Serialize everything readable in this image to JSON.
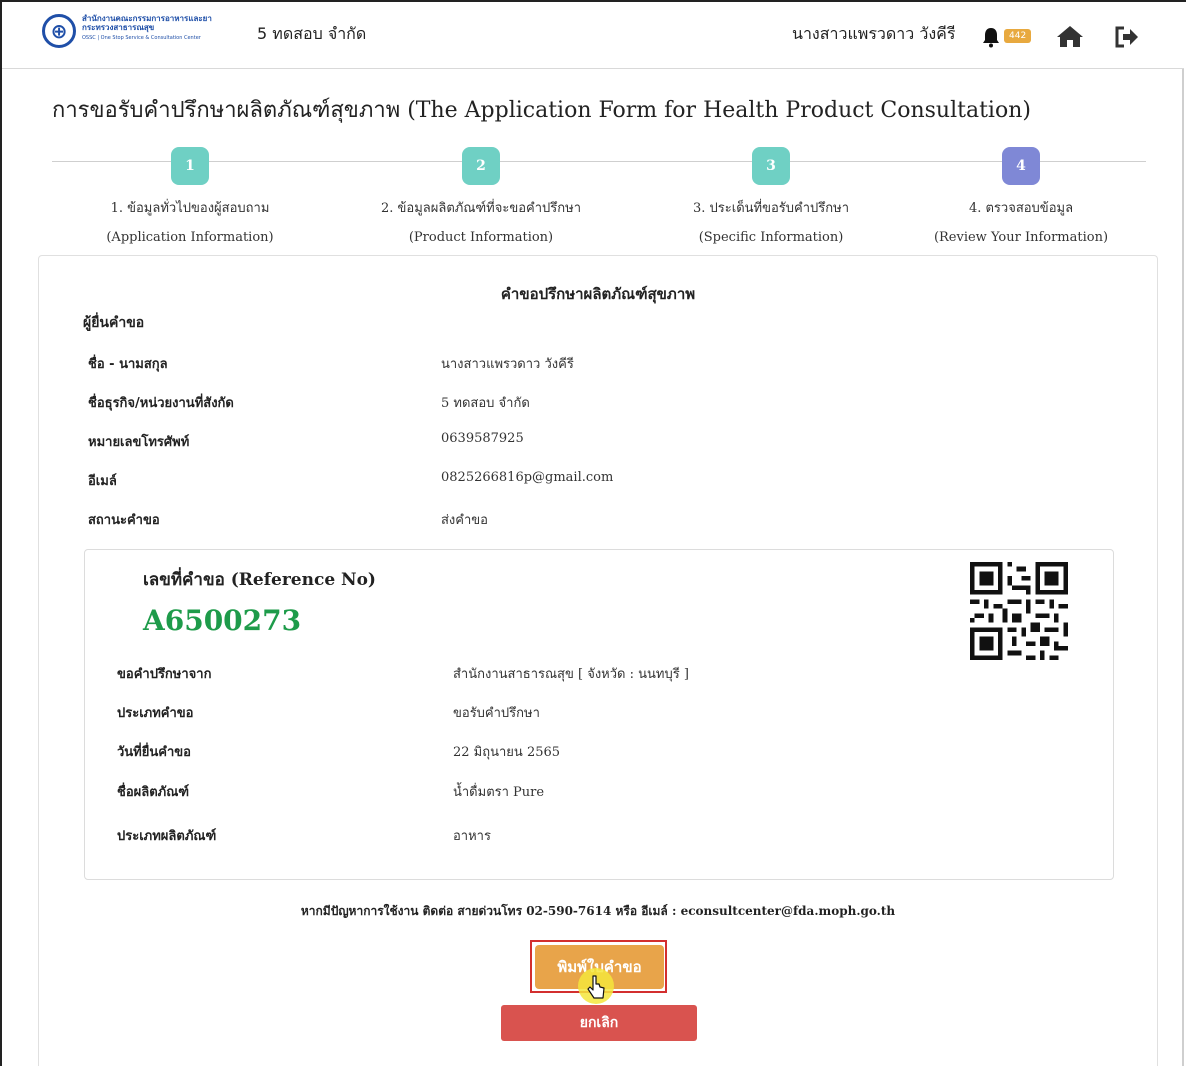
{
  "header": {
    "logo": {
      "line1": "สำนักงานคณะกรรมการอาหารและยา",
      "line2": "กระทรวงสาธารณสุข",
      "line3": "OSSC | One Stop Service & Consultation Center"
    },
    "company": "5 ทดสอบ จำกัด",
    "user_name": "นางสาวแพรวดาว วังคีรี",
    "notification_count": "442",
    "icons": [
      "bell-icon",
      "home-icon",
      "logout-icon"
    ]
  },
  "page_title": "การขอรับคำปรึกษาผลิตภัณฑ์สุขภาพ (The Application Form for Health Product Consultation)",
  "steps": [
    {
      "number": "1",
      "label_th": "1. ข้อมูลทั่วไปของผู้สอบถาม",
      "label_en": "(Application Information)",
      "color": "#6fd0c4"
    },
    {
      "number": "2",
      "label_th": "2. ข้อมูลผลิตภัณฑ์ที่จะขอคำปรึกษา",
      "label_en": "(Product Information)",
      "color": "#6fd0c4"
    },
    {
      "number": "3",
      "label_th": "3. ประเด็นที่ขอรับคำปรึกษา",
      "label_en": "(Specific Information)",
      "color": "#6fd0c4"
    },
    {
      "number": "4",
      "label_th": "4. ตรวจสอบข้อมูล",
      "label_en": "(Review Your Information)",
      "color": "#7f88d6"
    }
  ],
  "form": {
    "title": "คำขอปรึกษาผลิตภัณฑ์สุขภาพ",
    "applicant_heading": "ผู้ยื่นคำขอ",
    "applicant_rows": [
      {
        "label": "ชื่อ - นามสกุล",
        "value": "นางสาวแพรวดาว วังคีรี"
      },
      {
        "label": "ชื่อธุรกิจ/หน่วยงานที่สังกัด",
        "value": "5 ทดสอบ จำกัด"
      },
      {
        "label": "หมายเลขโทรศัพท์",
        "value": "0639587925"
      },
      {
        "label": "อีเมล์",
        "value": "0825266816p@gmail.com"
      },
      {
        "label": "สถานะคำขอ",
        "value": "ส่งคำขอ"
      }
    ],
    "reference": {
      "label": "เลขที่คำขอ (Reference No)",
      "number": "A6500273",
      "color": "#1e9b4a"
    },
    "request_rows": [
      {
        "label": "ขอคำปรึกษาจาก",
        "value": "สำนักงานสาธารณสุข [ จังหวัด : นนทบุรี ]"
      },
      {
        "label": "ประเภทคำขอ",
        "value": "ขอรับคำปรึกษา"
      },
      {
        "label": "วันที่ยื่นคำขอ",
        "value": "22 มิถุนายน 2565"
      },
      {
        "label": "ชื่อผลิตภัณฑ์",
        "value": "น้ำดื่มตรา Pure"
      },
      {
        "label": "ประเภทผลิตภัณฑ์",
        "value": "อาหาร"
      }
    ],
    "help_text": "หากมีปัญหาการใช้งาน ติดต่อ สายด่วนโทร 02-590-7614 หรือ อีเมล์ : econsultcenter@fda.moph.go.th",
    "print_button": "พิมพ์ใบคำขอ",
    "cancel_button": "ยกเลิก"
  },
  "colors": {
    "print_button": "#e8a44a",
    "cancel_button": "#d9534f",
    "highlight_border": "#d32f2f"
  }
}
